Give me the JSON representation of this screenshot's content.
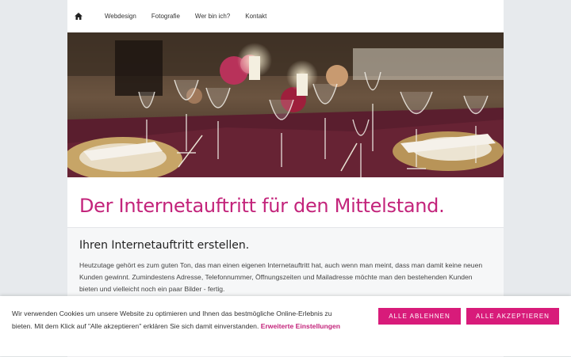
{
  "nav": {
    "home_icon": "home-icon",
    "items": [
      "Webdesign",
      "Fotografie",
      "Wer bin ich?",
      "Kontakt"
    ]
  },
  "hero": {
    "alt": "Festlich gedeckter Tisch mit Weingläsern und Kerzen"
  },
  "main": {
    "title": "Der Internetauftritt für den Mittelstand.",
    "subtitle": "Ihren Internetauftritt erstellen.",
    "paragraph": "Heutzutage gehört es zum guten Ton, das man einen eigenen Internetauftritt hat, auch wenn man meint, dass man damit keine neuen Kunden gewinnt. Zumindestens Adresse, Telefonnummer, Öffnungszeiten und Mailadresse möchte man den bestehenden Kunden bieten und vielleicht noch ein paar Bilder - fertig."
  },
  "cookie": {
    "message": "Wir verwenden Cookies um unsere Website zu optimieren und Ihnen das bestmögliche Online-Erlebnis zu bieten. Mit dem Klick auf \"Alle akzeptieren\" erklären Sie sich damit einverstanden.",
    "settings_link": "Erweiterte Einstellungen",
    "reject_label": "ALLE ABLEHNEN",
    "accept_label": "ALLE AKZEPTIEREN"
  },
  "colors": {
    "accent": "#c3247b",
    "button": "#d81b7a",
    "background": "#e7eaed"
  }
}
